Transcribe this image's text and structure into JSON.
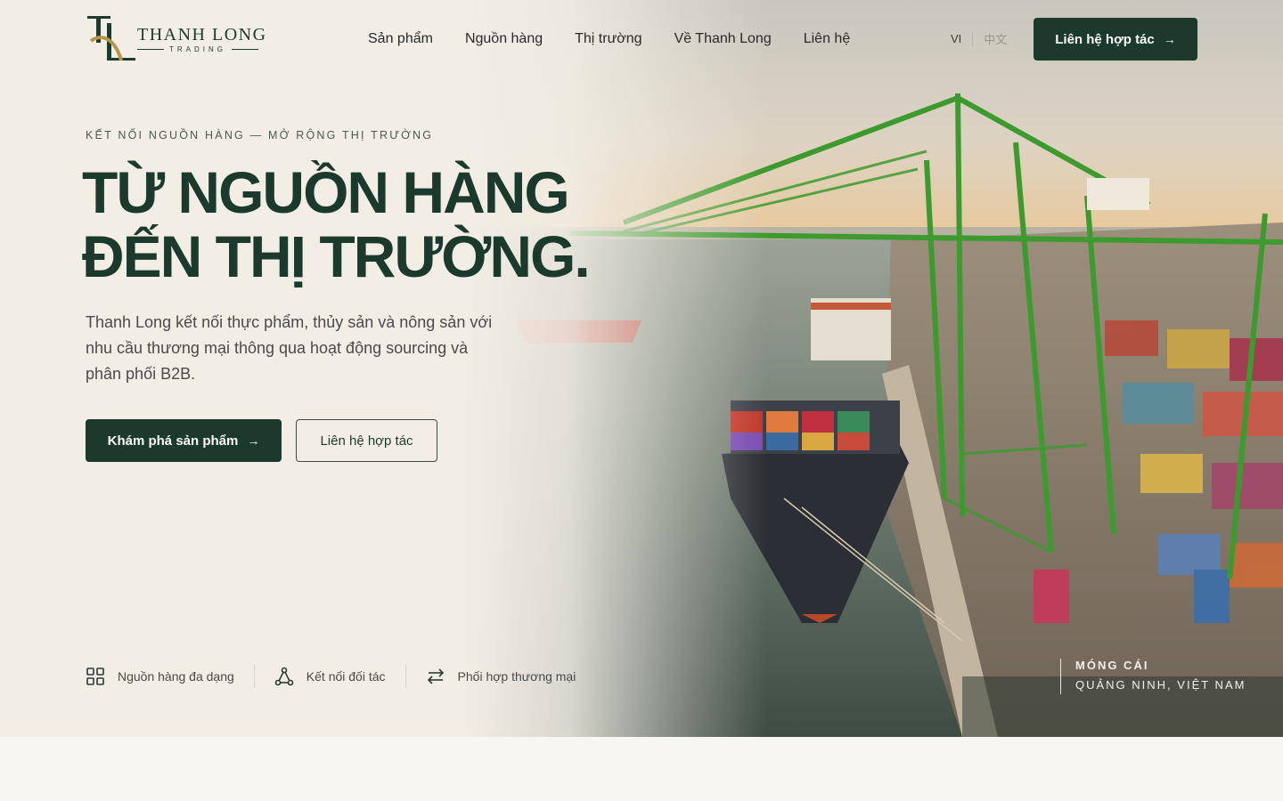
{
  "brand": {
    "name": "THANH LONG",
    "sub": "TRADING"
  },
  "nav": {
    "items": [
      {
        "label": "Sản phẩm"
      },
      {
        "label": "Nguồn hàng"
      },
      {
        "label": "Thị trường"
      },
      {
        "label": "Về Thanh Long"
      },
      {
        "label": "Liên hệ"
      }
    ]
  },
  "lang": {
    "vi": "VI",
    "zh": "中文"
  },
  "header": {
    "cta_label": "Liên hệ hợp tác"
  },
  "hero": {
    "eyebrow": "KẾT NỐI NGUỒN HÀNG — MỞ RỘNG THỊ TRƯỜNG",
    "headline_line1": "TỪ NGUỒN HÀNG",
    "headline_line2": "ĐẾN THỊ TRƯỜNG.",
    "lead": "Thanh Long kết nối thực phẩm, thủy sản và nông sản với nhu cầu thương mại thông qua hoạt động sourcing và phân phối B2B.",
    "primary_cta": "Khám phá sản phẩm",
    "secondary_cta": "Liên hệ hợp tác"
  },
  "features": [
    {
      "label": "Nguồn hàng đa dạng",
      "icon": "grid-icon"
    },
    {
      "label": "Kết nối đối tác",
      "icon": "network-icon"
    },
    {
      "label": "Phối hợp thương mại",
      "icon": "swap-icon"
    }
  ],
  "location": {
    "city": "MÓNG CÁI",
    "region": "QUẢNG NINH, VIỆT NAM"
  },
  "colors": {
    "primary": "#1b3a2d",
    "background": "#f2eee6",
    "crane": "#3c9a2e"
  }
}
